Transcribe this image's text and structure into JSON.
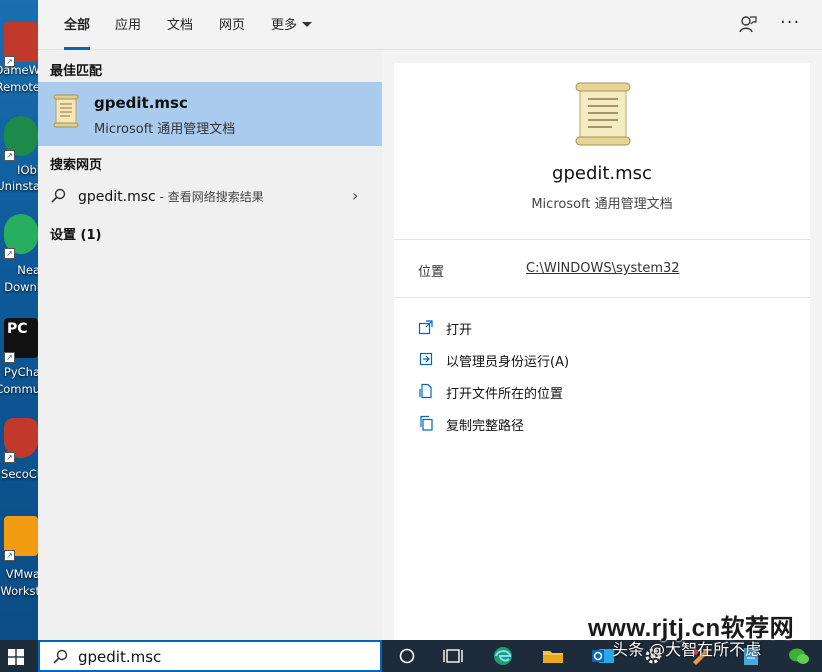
{
  "desktop": {
    "icons": [
      {
        "label1": "DameW",
        "label2": "Remote",
        "color": "#c0392b"
      },
      {
        "label1": "IObi",
        "label2": "Uninsta",
        "color": "#1e8a4a"
      },
      {
        "label1": "Nea",
        "label2": "Downl",
        "color": "#27ae60"
      },
      {
        "label1": "PyCha",
        "label2": "Commu",
        "color": "#111111"
      },
      {
        "label1": "SecoCl",
        "label2": "",
        "color": "#c0392b"
      },
      {
        "label1": "VMwa",
        "label2": "Workst",
        "color": "#f39c12"
      }
    ]
  },
  "tabs": [
    {
      "label": "全部",
      "active": true
    },
    {
      "label": "应用"
    },
    {
      "label": "文档"
    },
    {
      "label": "网页"
    },
    {
      "label": "更多"
    }
  ],
  "left": {
    "best_match_header": "最佳匹配",
    "best_match": {
      "name": "gpedit.msc",
      "type": "Microsoft 通用管理文档"
    },
    "web_header": "搜索网页",
    "web_item": {
      "query": "gpedit.msc",
      "hint": " - 查看网络搜索结果"
    },
    "settings_header": "设置 (1)"
  },
  "right": {
    "title": "gpedit.msc",
    "subtitle": "Microsoft 通用管理文档",
    "location_label": "位置",
    "location_path": "C:\\WINDOWS\\system32",
    "actions": [
      "打开",
      "以管理员身份运行(A)",
      "打开文件所在的位置",
      "复制完整路径"
    ]
  },
  "taskbar": {
    "search_value": "gpedit.msc"
  },
  "watermark": {
    "site": "www.rjtj.cn软荐网",
    "author": "头条 @大智在所不虑"
  },
  "colors": {
    "accent": "#0067c0",
    "selected": "#a9cbee"
  }
}
